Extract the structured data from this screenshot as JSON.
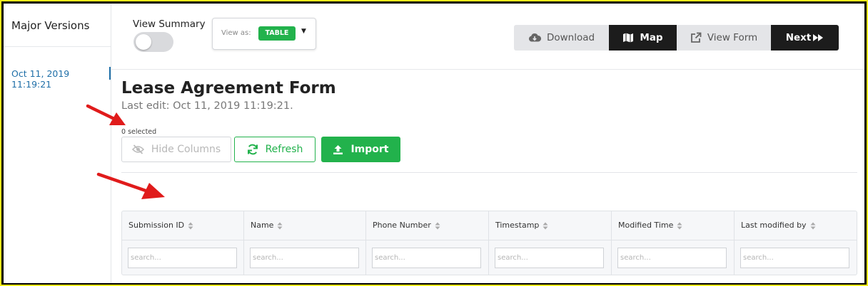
{
  "sidebar": {
    "title": "Major Versions",
    "versions": [
      "Oct 11, 2019 11:19:21"
    ]
  },
  "view_summary": {
    "label": "View Summary",
    "enabled": false
  },
  "view_as": {
    "label": "View as:",
    "value": "TABLE"
  },
  "toolbar": {
    "download": "Download",
    "map": "Map",
    "view_form": "View Form",
    "next": "Next"
  },
  "form": {
    "title": "Lease Agreement Form",
    "last_edit": "Last edit: Oct 11, 2019 11:19:21."
  },
  "selection": {
    "text": "0 selected"
  },
  "actions": {
    "hide_columns": "Hide Columns",
    "refresh": "Refresh",
    "import": "Import"
  },
  "table": {
    "columns": [
      "Submission ID",
      "Name",
      "Phone Number",
      "Timestamp",
      "Modified Time",
      "Last modified by"
    ],
    "search_placeholder": "search..."
  },
  "colors": {
    "accent_green": "#22b24c",
    "dark_button": "#1c1c1c",
    "link_blue": "#1f6fa8",
    "arrow_red": "#e01b1b",
    "frame_yellow": "#f2ea1a"
  }
}
